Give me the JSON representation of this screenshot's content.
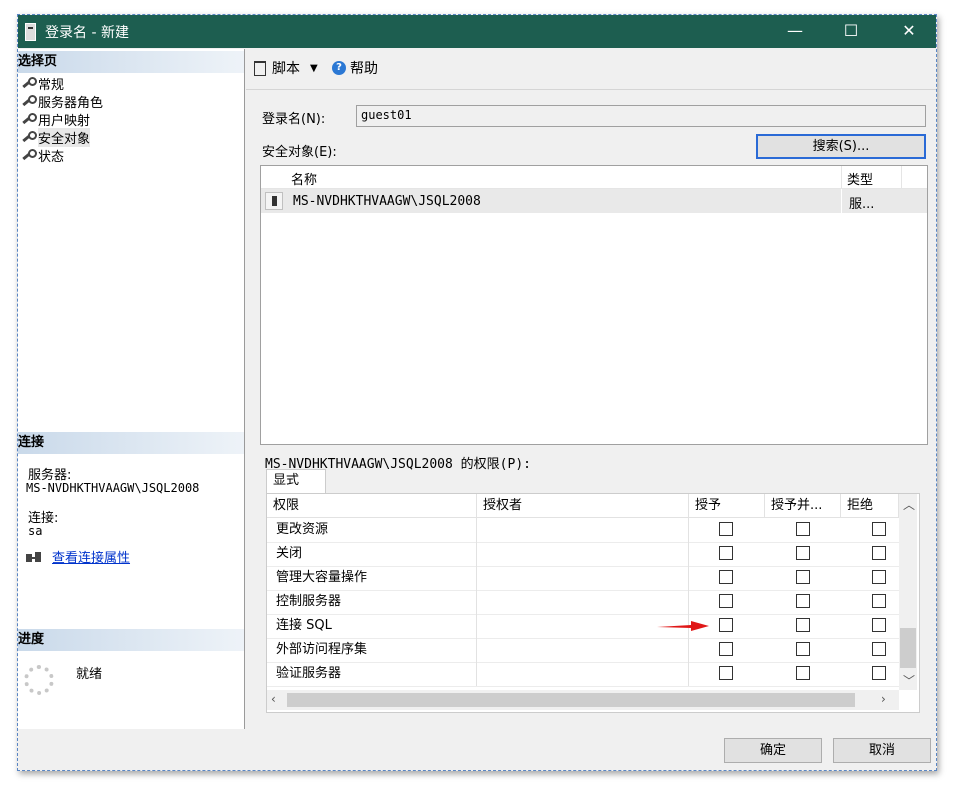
{
  "window": {
    "title": "登录名 - 新建",
    "minimize": "—",
    "maximize": "☐",
    "close": "✕"
  },
  "left": {
    "select_page": "选择页",
    "pages": [
      "常规",
      "服务器角色",
      "用户映射",
      "安全对象",
      "状态"
    ],
    "connection": {
      "header": "连接",
      "server_label": "服务器:",
      "server_value": "MS-NVDHKTHVAAGW\\JSQL2008",
      "conn_label": "连接:",
      "conn_value": "sa",
      "view_props": "查看连接属性"
    },
    "progress": {
      "header": "进度",
      "status": "就绪"
    }
  },
  "toolbar": {
    "script": "脚本",
    "dropdown": "▼",
    "help": "帮助"
  },
  "form": {
    "login_label": "登录名(N):",
    "login_value": "guest01",
    "securables_label": "安全对象(E):",
    "search_button": "搜索(S)..."
  },
  "securables": {
    "columns": [
      "名称",
      "类型"
    ],
    "rows": [
      {
        "name": "MS-NVDHKTHVAAGW\\JSQL2008",
        "type": "服..."
      }
    ]
  },
  "permissions": {
    "label": "MS-NVDHKTHVAAGW\\JSQL2008 的权限(P):",
    "tab": "显式",
    "columns": [
      "权限",
      "授权者",
      "授予",
      "授予并...",
      "拒绝"
    ],
    "rows": [
      {
        "perm": "更改资源",
        "grantor": "",
        "grant": false,
        "with_grant": false,
        "deny": false
      },
      {
        "perm": "关闭",
        "grantor": "",
        "grant": false,
        "with_grant": false,
        "deny": false
      },
      {
        "perm": "管理大容量操作",
        "grantor": "",
        "grant": false,
        "with_grant": false,
        "deny": false
      },
      {
        "perm": "控制服务器",
        "grantor": "",
        "grant": false,
        "with_grant": false,
        "deny": false
      },
      {
        "perm": "连接 SQL",
        "grantor": "",
        "grant": false,
        "with_grant": false,
        "deny": false
      },
      {
        "perm": "外部访问程序集",
        "grantor": "",
        "grant": false,
        "with_grant": false,
        "deny": false
      },
      {
        "perm": "验证服务器",
        "grantor": "",
        "grant": false,
        "with_grant": false,
        "deny": false
      }
    ]
  },
  "footer": {
    "ok": "确定",
    "cancel": "取消"
  },
  "colors": {
    "titlebar": "#1d5e50",
    "arrow": "#e01818",
    "link": "#0033cc"
  }
}
